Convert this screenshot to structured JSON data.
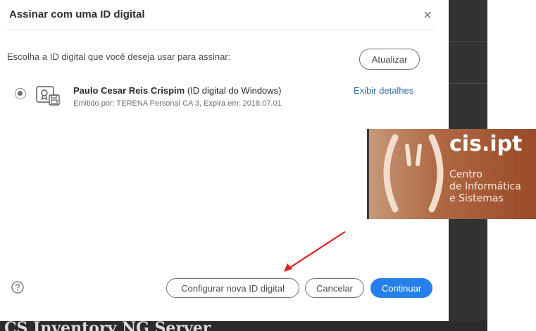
{
  "dialog": {
    "title": "Assinar com uma ID digital",
    "instruction": "Escolha a ID digital que você deseja usar para assinar:",
    "refresh_label": "Atualizar",
    "certificate": {
      "name": "Paulo Cesar Reis Crispim",
      "type": " (ID digital do Windows)",
      "issuer": "Emitido por: TERENA Personal CA 3, Expira em: 2018.07.01",
      "details_link": "Exibir detalhes",
      "selected": true
    },
    "buttons": {
      "configure": "Configurar nova ID digital",
      "cancel": "Cancelar",
      "continue": "Continuar"
    },
    "icons": {
      "close": "close-icon",
      "help": "help-icon",
      "certificate": "certificate-icon"
    },
    "colors": {
      "primary": "#2680eb",
      "link": "#2d6db5",
      "annotation_arrow": "#e02020"
    }
  },
  "logo": {
    "brand": "cis.ipt",
    "line1": "Centro",
    "line2": "de Informática",
    "line3": "e Sistemas"
  },
  "background": {
    "bottom_text": "CS Inventory NG Server"
  }
}
